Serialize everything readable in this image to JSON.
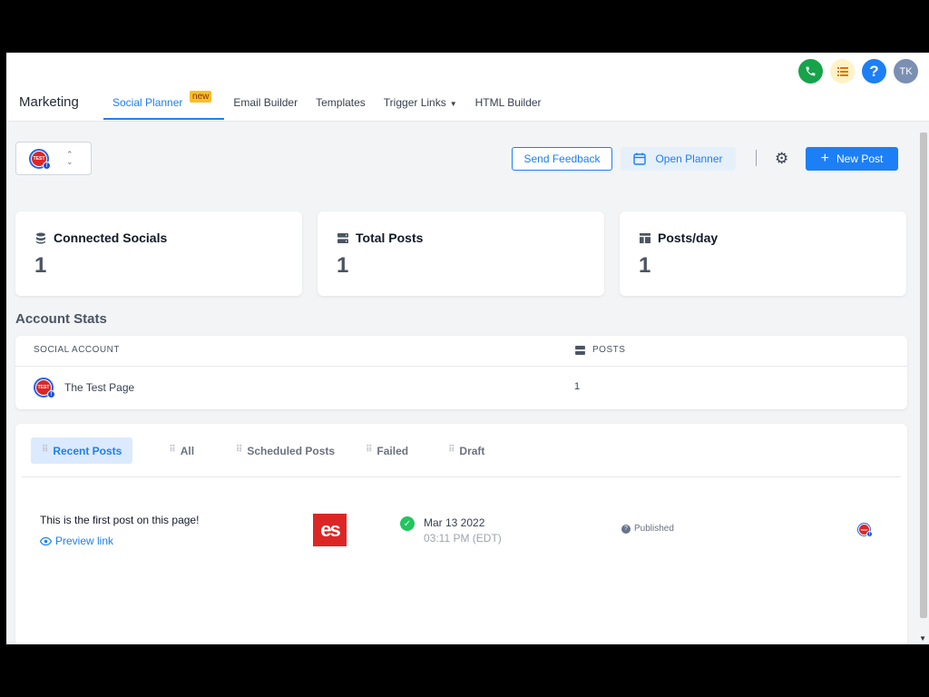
{
  "header": {
    "brand": "Marketing",
    "tabs": [
      {
        "label": "Social Planner",
        "badge": "new"
      },
      {
        "label": "Email Builder"
      },
      {
        "label": "Templates"
      },
      {
        "label": "Trigger Links"
      },
      {
        "label": "HTML Builder"
      }
    ],
    "avatar_initials": "TK"
  },
  "toolbar": {
    "account_avatar_text": "TEST",
    "send_feedback": "Send Feedback",
    "open_planner": "Open Planner",
    "new_post": "New Post"
  },
  "stats_cards": [
    {
      "title": "Connected Socials",
      "value": "1",
      "icon": "database-icon"
    },
    {
      "title": "Total Posts",
      "value": "1",
      "icon": "server-icon"
    },
    {
      "title": "Posts/day",
      "value": "1",
      "icon": "layout-icon"
    }
  ],
  "account_stats": {
    "title": "Account Stats",
    "col_account": "SOCIAL ACCOUNT",
    "col_posts": "POSTS",
    "rows": [
      {
        "name": "The Test Page",
        "posts": "1"
      }
    ]
  },
  "posts": {
    "tabs": [
      "Recent Posts",
      "All",
      "Scheduled Posts",
      "Failed",
      "Draft"
    ],
    "active_tab": "Recent Posts",
    "items": [
      {
        "text": "This is the first post on this page!",
        "preview": "Preview link",
        "thumb_text": "es",
        "date": "Mar 13 2022",
        "time": "03:11 PM (EDT)",
        "status": "Published"
      }
    ]
  },
  "colors": {
    "accent": "#1d7ff5",
    "success": "#22c55e",
    "badge": "#fbbf24"
  }
}
